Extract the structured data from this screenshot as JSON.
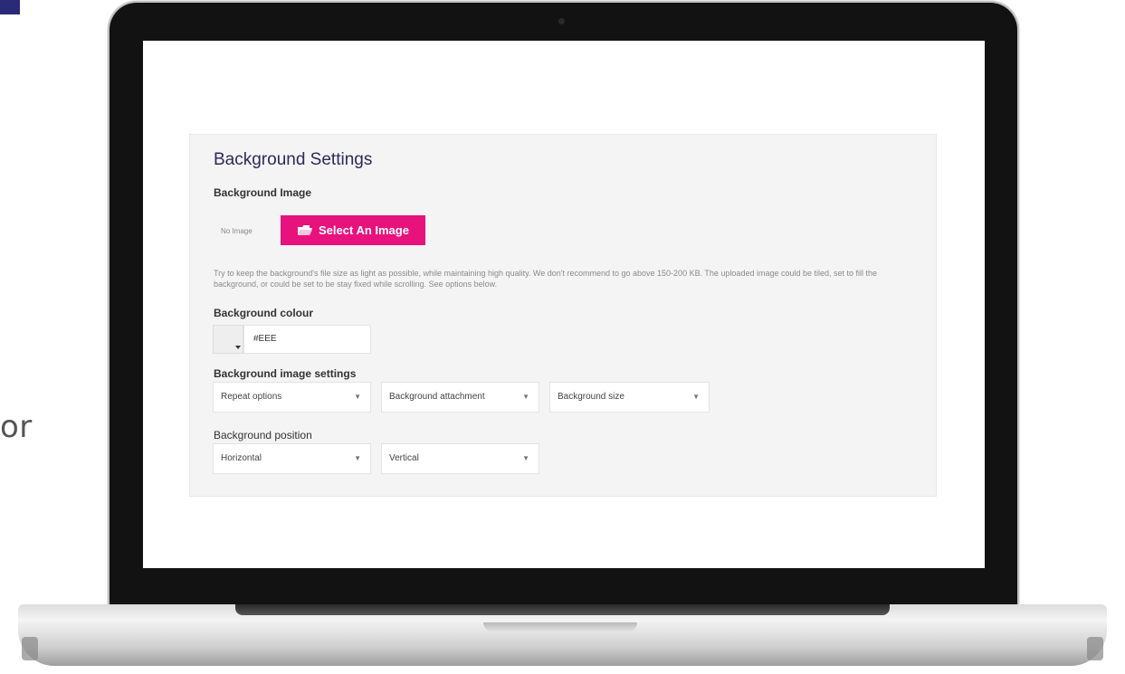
{
  "side_text": "or",
  "background_settings": {
    "title": "Background Settings",
    "image_label": "Background Image",
    "no_image_text": "No Image",
    "select_button_label": "Select An Image",
    "help_text": "Try to keep the background's file size as light as possible, while maintaining high quality. We don't recommend to go above 150-200 KB. The uploaded image could be tiled, set to fill the background, or could be set to be stay fixed while scrolling. See options below.",
    "colour_label": "Background colour",
    "colour_value": "#EEE",
    "image_settings_label": "Background image settings",
    "image_settings_options": [
      "Repeat options",
      "Background attachment",
      "Background size"
    ],
    "position_label": "Background position",
    "position_options": [
      "Horizontal",
      "Vertical"
    ]
  },
  "colors": {
    "accent": "#e8127d",
    "title": "#2b2a5c",
    "panel": "#f4f4f4",
    "corner_block": "#2b2a78"
  },
  "icons": {
    "select_button": "folder-icon",
    "dropdown": "chevron-down-icon",
    "swatch": "caret-down-icon"
  }
}
